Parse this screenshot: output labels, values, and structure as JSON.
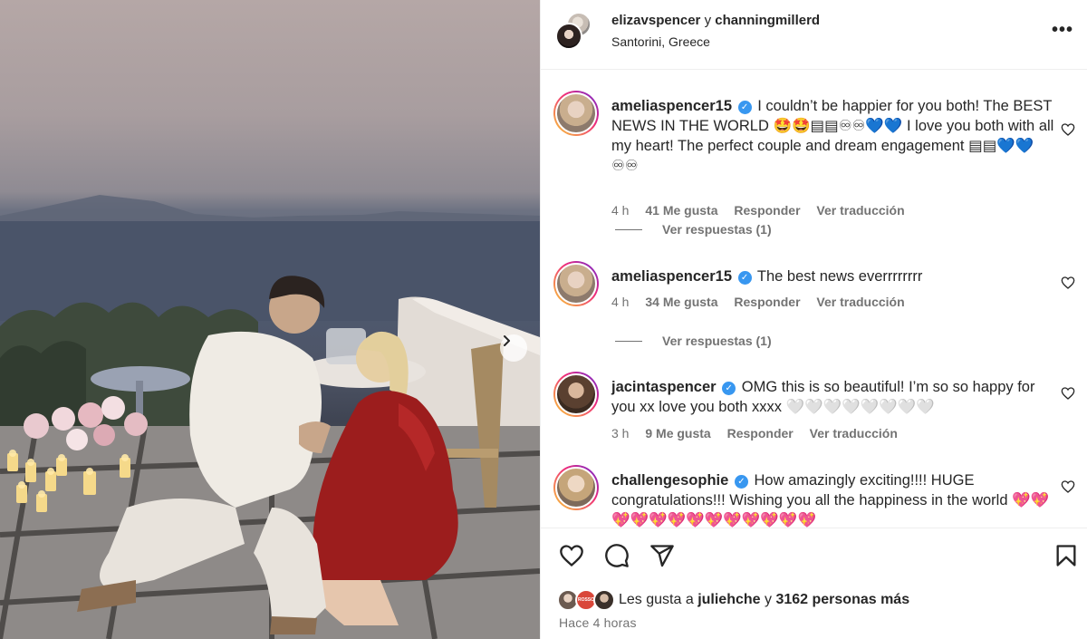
{
  "post": {
    "author_1": "elizavspencer",
    "connector": "y",
    "author_2": "channingmillerd",
    "location": "Santorini, Greece",
    "more_label": "•••"
  },
  "comments": [
    {
      "user": "ameliaspencer15",
      "text": "I couldn’t be happier for you both! The BEST NEWS IN THE WORLD 🤩🤩▤▤♾♾💙💙 I love you both with all my heart! The perfect couple and dream engagement ▤▤💙💙♾♾",
      "time": "4 h",
      "likes": "41 Me gusta",
      "reply": "Responder",
      "translate": "Ver traducción",
      "replies": "Ver respuestas (1)"
    },
    {
      "user": "ameliaspencer15",
      "text": "The best news everrrrrrrr",
      "time": "4 h",
      "likes": "34 Me gusta",
      "reply": "Responder",
      "translate": "Ver traducción",
      "replies": "Ver respuestas (1)"
    },
    {
      "user": "jacintaspencer",
      "text": "OMG this is so beautiful! I’m so so happy for you xx love you both xxxx 🤍🤍🤍🤍🤍🤍🤍🤍",
      "time": "3 h",
      "likes": "9 Me gusta",
      "reply": "Responder",
      "translate": "Ver traducción"
    },
    {
      "user": "challengesophie",
      "text": "How amazingly exciting!!!! HUGE congratulations!!! Wishing you all the happiness in the world 💖💖💖💖💖💖💖💖💖💖💖💖💖"
    }
  ],
  "likes_bar": {
    "prefix": "Les gusta a",
    "user": "juliehche",
    "connector": "y",
    "others": "3162 personas más",
    "avatar_badge": "ROSSO"
  },
  "timestamp": "Hace 4 horas",
  "colors": {
    "verified": "#3897f0",
    "story_ring_start": "#f9ce34",
    "story_ring_end": "#6228d7",
    "muted_text": "#737373"
  },
  "icons": [
    "chevron-right-icon",
    "more-icon",
    "verified-icon",
    "heart-icon",
    "comment-icon",
    "share-icon",
    "bookmark-icon"
  ]
}
